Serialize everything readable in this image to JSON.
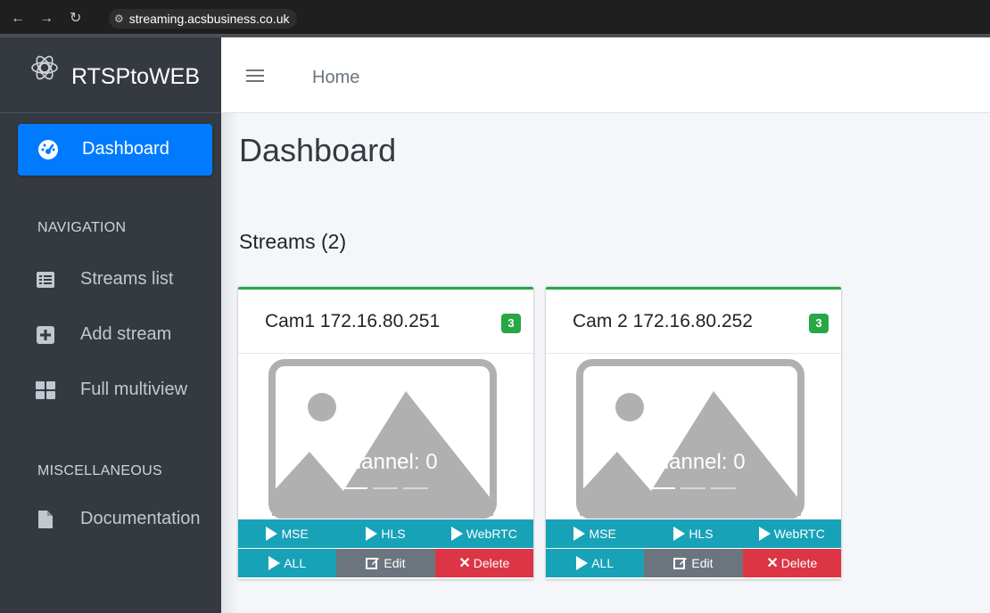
{
  "browser": {
    "url": "streaming.acsbusiness.co.uk",
    "back_icon": "arrow-left-icon",
    "forward_icon": "arrow-right-icon",
    "reload_icon": "reload-icon"
  },
  "sidebar": {
    "brand": "RTSPtoWEB",
    "active_item": "Dashboard",
    "sections": [
      {
        "header": "NAVIGATION",
        "items": [
          "Streams list",
          "Add stream",
          "Full multiview"
        ]
      },
      {
        "header": "MISCELLANEOUS",
        "items": [
          "Documentation"
        ]
      }
    ]
  },
  "topbar": {
    "breadcrumb": "Home"
  },
  "main": {
    "title": "Dashboard",
    "streams_title": "Streams (2)",
    "streams": [
      {
        "name": "Cam1 172.16.80.251",
        "badge": "3",
        "channel": "Channel: 0",
        "buttons": [
          "MSE",
          "HLS",
          "WebRTC",
          "ALL",
          "Edit",
          "Delete"
        ]
      },
      {
        "name": "Cam 2 172.16.80.252",
        "badge": "3",
        "channel": "Channel: 0",
        "buttons": [
          "MSE",
          "HLS",
          "WebRTC",
          "ALL",
          "Edit",
          "Delete"
        ]
      }
    ]
  },
  "colors": {
    "sidebar": "#343a40",
    "primary": "#007bff",
    "success": "#28a745",
    "info": "#17a2b8",
    "secondary": "#6c757d",
    "danger": "#dc3545"
  }
}
